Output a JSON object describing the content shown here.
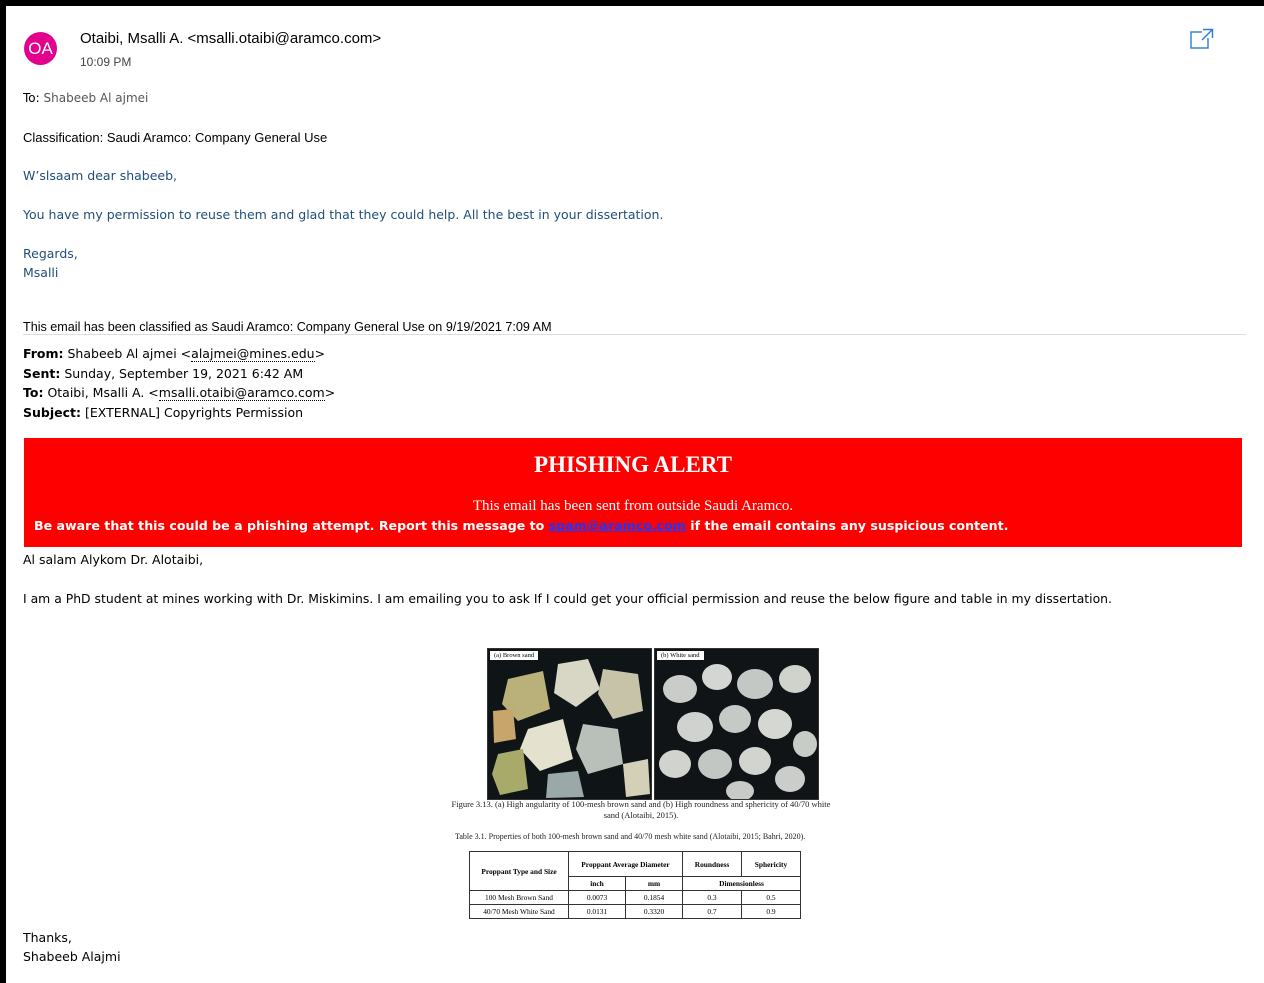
{
  "header": {
    "avatar_initials": "OA",
    "sender": "Otaibi, Msalli A. <msalli.otaibi@aramco.com>",
    "time": "10:09 PM",
    "to_label": "To:",
    "to_value": "Shabeeb Al ajmei"
  },
  "reply": {
    "classification_label": "Classification:",
    "classification_value": "Saudi Aramco: Company General Use",
    "greeting": "W’slsaam dear shabeeb,",
    "body": "You have my permission to reuse them and glad that they could help. All the best in  your dissertation.",
    "regards": "Regards,",
    "name": "Msalli",
    "classified_prefix": "This email has been classified as Saudi Aramco: Company General Use on ",
    "classified_date": "9/19/2021 7:09",
    "classified_suffix": " AM"
  },
  "original": {
    "from_label": "From:",
    "from_name": "Shabeeb Al ajmei <",
    "from_email": "alajmei@mines.edu",
    "from_close": ">",
    "sent_label": "Sent:",
    "sent_value": "Sunday, September 19, 2021 6:42 AM",
    "to_label": "To:",
    "to_name": "Otaibi, Msalli A. <",
    "to_email": "msalli.otaibi@aramco.com",
    "to_close": ">",
    "subject_label": "Subject:",
    "subject_value": "[EXTERNAL] Copyrights Permission"
  },
  "alert": {
    "title": "PHISHING ALERT",
    "line1": "This email has been sent from outside Saudi Aramco.",
    "line2_pre": "Be aware that this could be a phishing attempt. Report this message to ",
    "link": "spam@aramco.com",
    "line2_post": " if the email contains any suspicious content.",
    "bg_color": "#ff0000"
  },
  "message": {
    "salutation": "Al salam Alykom Dr. Alotaibi,",
    "body": "I am a PhD student at mines working with Dr. Miskimins. I am emailing you to ask If I could get your official permission and reuse the below figure and table in my dissertation.",
    "thanks": "Thanks,",
    "signature": "Shabeeb Alajmi"
  },
  "figure": {
    "label_a": "(a)   Brown sand",
    "label_b": "(b)   White sand",
    "caption": "Figure 3.13. (a) High angularity of 100-mesh brown sand and (b) High roundness and sphericity of 40/70 white sand (Alotaibi, 2015).",
    "table_caption": "Table 3.1. Properties of both 100-mesh brown sand and 40/70 mesh white sand (Alotaibi, 2015; Bahri, 2020).",
    "table": {
      "h_type": "Proppant Type and Size",
      "h_diam": "Proppant Average Diameter",
      "h_round": "Roundness",
      "h_spher": "Sphericity",
      "unit_inch": "inch",
      "unit_mm": "mm",
      "unit_dimless": "Dimensionless",
      "rows": [
        {
          "type": "100 Mesh Brown Sand",
          "inch": "0.0073",
          "mm": "0.1854",
          "round": "0.3",
          "spher": "0.5"
        },
        {
          "type": "40/70 Mesh White Sand",
          "inch": "0.0131",
          "mm": "0.3320",
          "round": "0.7",
          "spher": "0.9"
        }
      ]
    }
  },
  "icons": {
    "popout": "open-in-new-window-icon"
  }
}
